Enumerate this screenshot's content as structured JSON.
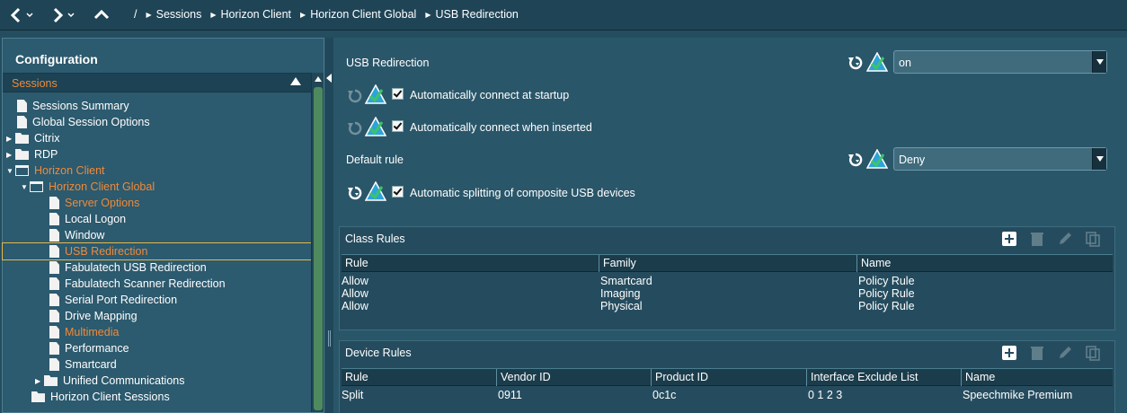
{
  "nav": {
    "crumbs": [
      "Sessions",
      "Horizon Client",
      "Horizon Client Global",
      "USB Redirection"
    ],
    "slash": "/"
  },
  "left": {
    "title": "Configuration",
    "section": "Sessions",
    "tree": [
      {
        "label": "Sessions Summary"
      },
      {
        "label": "Global Session Options"
      },
      {
        "label": "Citrix"
      },
      {
        "label": "RDP"
      },
      {
        "label": "Horizon Client"
      },
      {
        "label": "Horizon Client Global"
      },
      {
        "label": "Server Options"
      },
      {
        "label": "Local Logon"
      },
      {
        "label": "Window"
      },
      {
        "label": "USB Redirection"
      },
      {
        "label": "Fabulatech USB Redirection"
      },
      {
        "label": "Fabulatech Scanner Redirection"
      },
      {
        "label": "Serial Port Redirection"
      },
      {
        "label": "Drive Mapping"
      },
      {
        "label": "Multimedia"
      },
      {
        "label": "Performance"
      },
      {
        "label": "Smartcard"
      },
      {
        "label": "Unified Communications"
      },
      {
        "label": "Horizon Client Sessions"
      }
    ]
  },
  "settings": {
    "usb_redirection_label": "USB Redirection",
    "usb_redirection_value": "on",
    "auto_connect_startup_label": "Automatically connect at startup",
    "auto_connect_inserted_label": "Automatically connect when inserted",
    "default_rule_label": "Default rule",
    "default_rule_value": "Deny",
    "auto_split_label": "Automatic splitting of composite USB devices"
  },
  "class_rules": {
    "title": "Class Rules",
    "columns": [
      "Rule",
      "Family",
      "Name"
    ],
    "rows": [
      [
        "Allow",
        "Smartcard",
        "Policy Rule"
      ],
      [
        "Allow",
        "Imaging",
        "Policy Rule"
      ],
      [
        "Allow",
        "Physical",
        "Policy Rule"
      ]
    ]
  },
  "device_rules": {
    "title": "Device Rules",
    "columns": [
      "Rule",
      "Vendor ID",
      "Product ID",
      "Interface Exclude List",
      "Name"
    ],
    "rows": [
      [
        "Split",
        "0911",
        "0c1c",
        "0 1 2 3",
        "Speechmike Premium"
      ]
    ]
  },
  "colors": {
    "accent_orange": "#ef8a3a",
    "background": "#254d60",
    "selection_outline": "#e7b94a",
    "scroll_thumb": "#4f8a5e"
  }
}
